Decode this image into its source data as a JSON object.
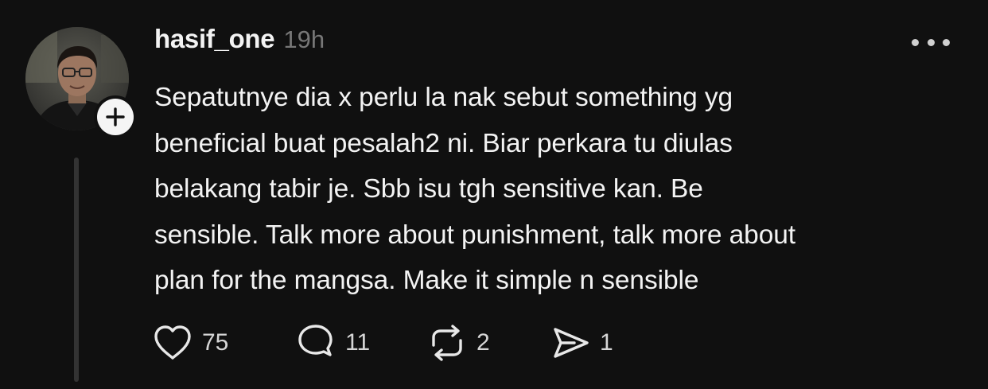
{
  "post": {
    "username": "hasif_one",
    "timestamp": "19h",
    "text": "Sepatutnye dia x perlu la nak sebut something yg\nbeneficial buat pesalah2 ni. Biar perkara tu diulas\nbelakang tabir je. Sbb isu tgh sensitive kan. Be\nsensible. Talk more about punishment, talk more about\nplan for the mangsa. Make it simple n sensible",
    "more_icon": "more-horizontal-icon",
    "follow_icon": "plus-icon"
  },
  "actions": {
    "like": {
      "icon": "heart-icon",
      "count": "75"
    },
    "reply": {
      "icon": "comment-icon",
      "count": "11"
    },
    "repost": {
      "icon": "repost-icon",
      "count": "2"
    },
    "share": {
      "icon": "send-icon",
      "count": "1"
    }
  },
  "colors": {
    "background": "#101010",
    "text": "#f3f3f3",
    "muted": "#777777",
    "thread_line": "#333333"
  }
}
